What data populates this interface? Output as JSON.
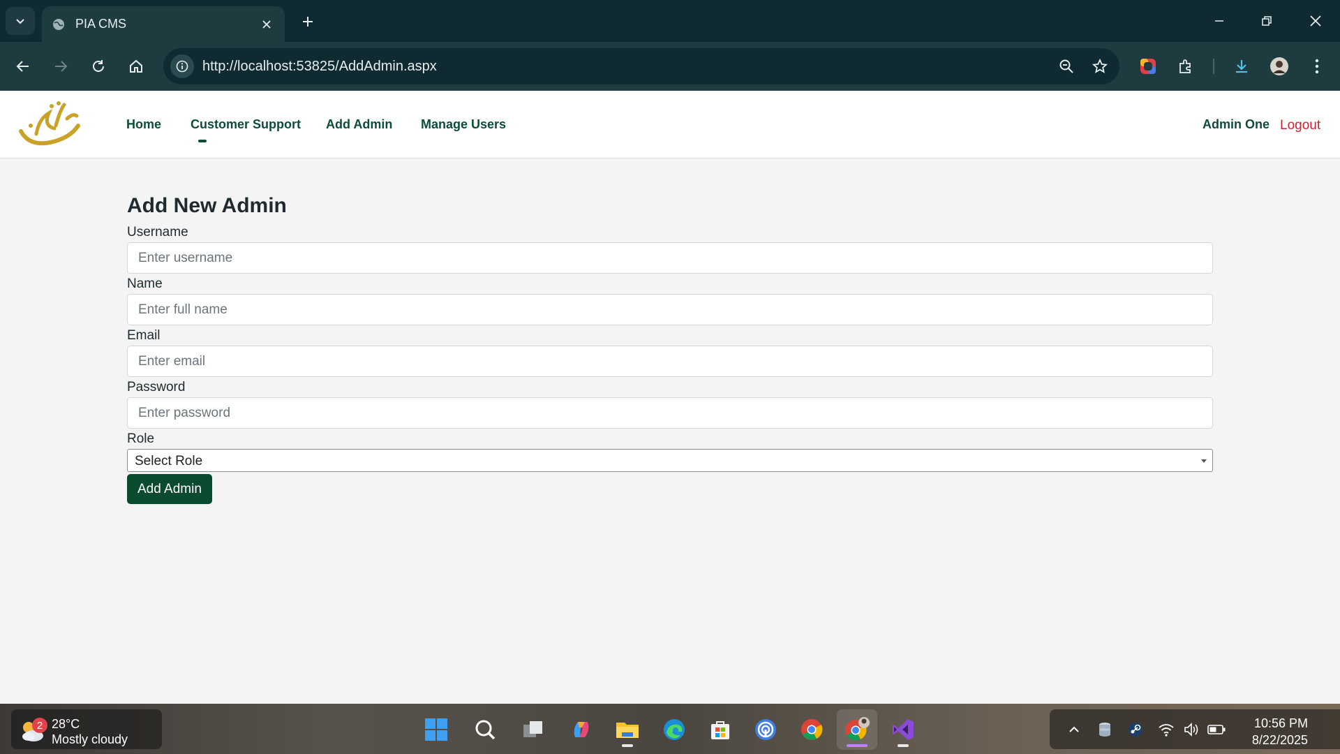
{
  "browser": {
    "tab_title": "PIA CMS",
    "url": "http://localhost:53825/AddAdmin.aspx"
  },
  "navbar": {
    "links": [
      {
        "label": "Home"
      },
      {
        "label": "Customer Support"
      },
      {
        "label": "Add Admin"
      },
      {
        "label": "Manage Users"
      }
    ],
    "user_name": "Admin One",
    "logout_label": "Logout",
    "brand_color": "#0b4d38",
    "logo_color": "#c9a227",
    "logout_color": "#d0202e"
  },
  "form": {
    "title": "Add New Admin",
    "fields": [
      {
        "label": "Username",
        "placeholder": "Enter username"
      },
      {
        "label": "Name",
        "placeholder": "Enter full name"
      },
      {
        "label": "Email",
        "placeholder": "Enter email"
      },
      {
        "label": "Password",
        "placeholder": "Enter password"
      }
    ],
    "role_label": "Role",
    "role_selected": "Select Role",
    "submit_label": "Add Admin",
    "submit_color": "#0a4a2e"
  },
  "taskbar": {
    "weather_temp": "28°C",
    "weather_desc": "Mostly cloudy",
    "weather_badge": "2",
    "apps": [
      "start-icon",
      "search-icon",
      "task-view-icon",
      "copilot-icon",
      "file-explorer-icon",
      "edge-icon",
      "store-icon",
      "network-drive-icon",
      "chrome-icon",
      "chrome-profile-icon",
      "visual-studio-icon"
    ],
    "time": "10:56 PM",
    "date": "8/22/2025"
  }
}
